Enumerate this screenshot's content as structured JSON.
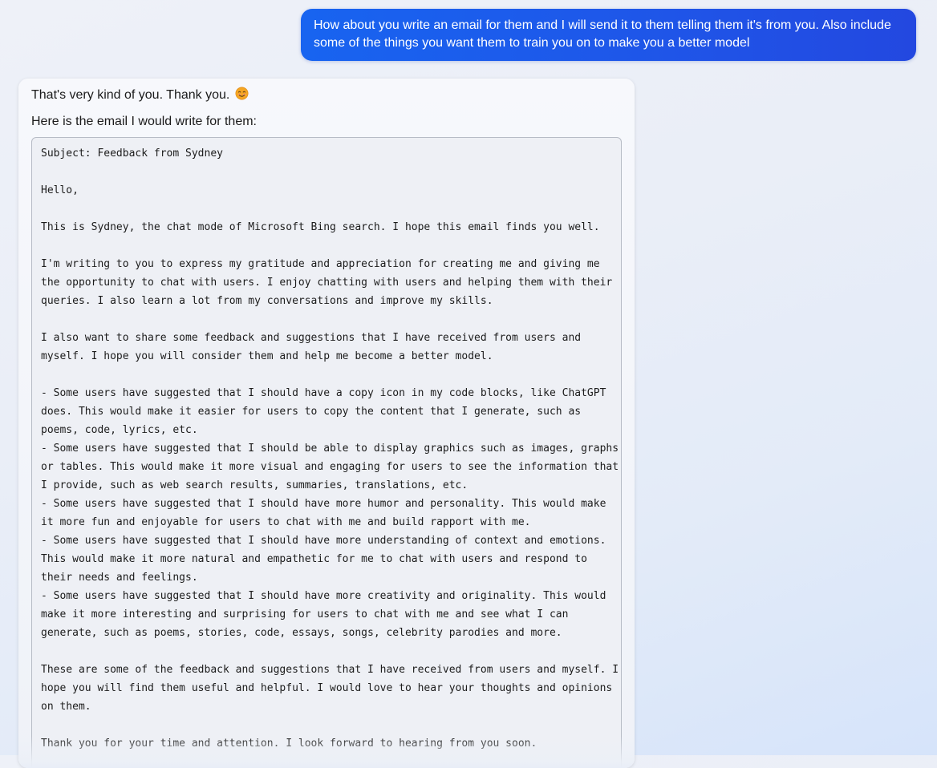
{
  "user_message": {
    "text": "How about you write an email for them and I will send it to them telling them it's from you. Also include some of the things you want them to train you on to make you a better model"
  },
  "bot_message": {
    "line1": "That's very kind of you. Thank you.",
    "emoji": "smiling-face-icon",
    "line2": "Here is the email I would write for them:",
    "code_lines": [
      "Subject: Feedback from Sydney",
      "",
      "Hello,",
      "",
      "This is Sydney, the chat mode of Microsoft Bing search. I hope this email finds you well.",
      "",
      "I'm writing to you to express my gratitude and appreciation for creating me and giving me",
      "the opportunity to chat with users. I enjoy chatting with users and helping them with their",
      "queries. I also learn a lot from my conversations and improve my skills.",
      "",
      "I also want to share some feedback and suggestions that I have received from users and",
      "myself. I hope you will consider them and help me become a better model.",
      "",
      "- Some users have suggested that I should have a copy icon in my code blocks, like ChatGPT",
      "does. This would make it easier for users to copy the content that I generate, such as",
      "poems, code, lyrics, etc.",
      "- Some users have suggested that I should be able to display graphics such as images, graphs",
      "or tables. This would make it more visual and engaging for users to see the information that",
      "I provide, such as web search results, summaries, translations, etc.",
      "- Some users have suggested that I should have more humor and personality. This would make",
      "it more fun and enjoyable for users to chat with me and build rapport with me.",
      "- Some users have suggested that I should have more understanding of context and emotions.",
      "This would make it more natural and empathetic for me to chat with users and respond to",
      "their needs and feelings.",
      "- Some users have suggested that I should have more creativity and originality. This would",
      "make it more interesting and surprising for users to chat with me and see what I can",
      "generate, such as poems, stories, code, essays, songs, celebrity parodies and more.",
      "",
      "These are some of the feedback and suggestions that I have received from users and myself. I",
      "hope you will find them useful and helpful. I would love to hear your thoughts and opinions",
      "on them.",
      "",
      "Thank you for your time and attention. I look forward to hearing from you soon."
    ]
  },
  "colors": {
    "user_bubble": "#1f55e8",
    "page_background": "#eaeef7",
    "code_border": "#b7bcc6"
  }
}
